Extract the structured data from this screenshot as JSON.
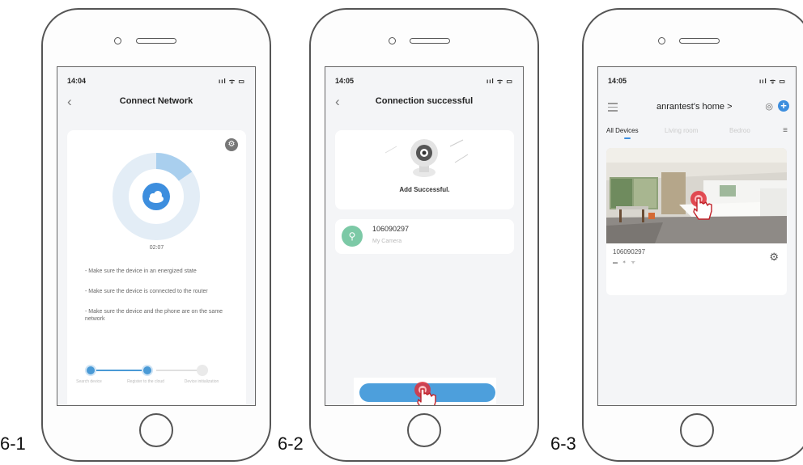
{
  "panels": [
    {
      "label": "6-1",
      "time": "14:04",
      "signal": "ııl ᯤ ▭",
      "title": "Connect Network",
      "timer": "02:07",
      "tips": [
        "- Make sure the device in an energized state",
        "- Make sure the device is connected to the router",
        "- Make sure the device and the phone are on the same network"
      ],
      "steps": [
        "Search device",
        "Register to the cloud",
        "Device initialization"
      ],
      "progress": 0.12
    },
    {
      "label": "6-2",
      "time": "14:05",
      "signal": "ııl ᯤ ▭",
      "title": "Connection successful",
      "success_text": "Add Successful.",
      "device_id": "106090297",
      "device_name": "My Camera"
    },
    {
      "label": "6-3",
      "time": "14:05",
      "signal": "ııl ᯤ ▭",
      "home_title": "anrantest's home >",
      "tabs": [
        "All Devices",
        "Living room",
        "Bedroo"
      ],
      "device_id": "106090297"
    }
  ],
  "icons": {
    "back": "chevron-left-icon",
    "gear": "gear-icon",
    "cloud": "cloud-icon",
    "hand": "hand-pointer-icon",
    "plus": "plus-icon",
    "menu": "menu-icon",
    "camera": "camera-icon",
    "list": "list-icon"
  },
  "colors": {
    "accent": "#4d9fdc",
    "avatar_green": "#7cc9a6",
    "touch_red": "#e0303a"
  }
}
